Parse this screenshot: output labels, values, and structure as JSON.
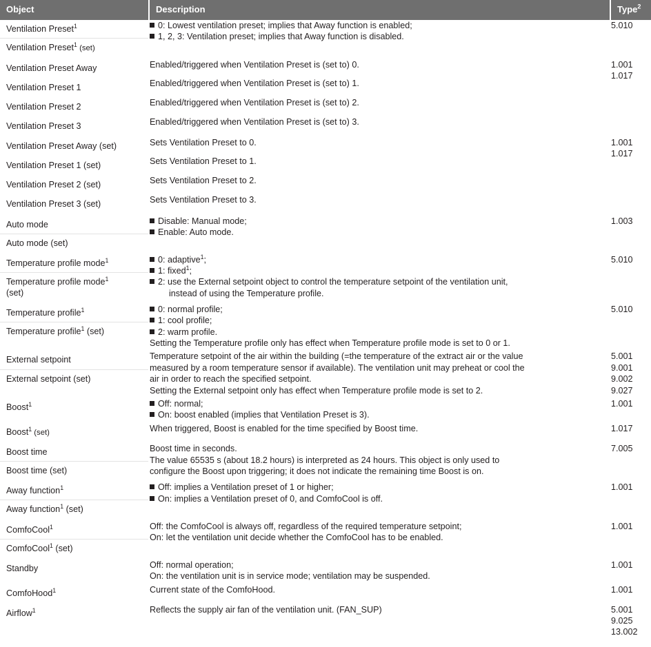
{
  "table": {
    "headers": {
      "object": "Object",
      "description": "Description",
      "type": "Type",
      "type_superscript": "2"
    },
    "header_bg": "#6f6f6f",
    "header_fg": "#ffffff",
    "groups": [
      {
        "objects": [
          {
            "name": "Ventilation Preset",
            "sup": "1",
            "suffix": ""
          },
          {
            "name": "Ventilation Preset",
            "sup": "1",
            "suffix": " (set)"
          }
        ],
        "description_lines": [
          {
            "bullet": true,
            "text": "0: Lowest ventilation preset; implies that Away function is enabled;"
          },
          {
            "bullet": true,
            "text": "1, 2, 3: Ventilation preset; implies that Away function is disabled."
          }
        ],
        "types": [
          "5.010"
        ]
      },
      {
        "objects": [
          {
            "name": "Ventilation Preset Away",
            "sup": "",
            "suffix": ""
          }
        ],
        "description_lines": [
          {
            "bullet": false,
            "text": "Enabled/triggered when Ventilation Preset is (set to) 0."
          }
        ],
        "types": [
          "1.001",
          "1.017"
        ],
        "rows": [
          {
            "object": "Ventilation Preset Away",
            "description": "Enabled/triggered when Ventilation Preset is (set to) 0."
          },
          {
            "object": "Ventilation Preset 1",
            "description": "Enabled/triggered when Ventilation Preset is (set to) 1."
          },
          {
            "object": "Ventilation Preset 2",
            "description": "Enabled/triggered when Ventilation Preset is (set to) 2."
          },
          {
            "object": "Ventilation Preset 3",
            "description": "Enabled/triggered when Ventilation Preset is (set to) 3."
          }
        ]
      },
      {
        "types": [
          "1.001",
          "1.017"
        ],
        "rows": [
          {
            "object": "Ventilation Preset Away (set)",
            "description": "Sets Ventilation Preset to 0."
          },
          {
            "object": "Ventilation Preset 1 (set)",
            "description": "Sets Ventilation Preset to 1."
          },
          {
            "object": "Ventilation Preset 2 (set)",
            "description": "Sets Ventilation Preset to 2."
          },
          {
            "object": "Ventilation Preset 3 (set)",
            "description": "Sets Ventilation Preset to 3."
          }
        ]
      },
      {
        "objects": [
          {
            "name": "Auto mode",
            "sup": "",
            "suffix": ""
          },
          {
            "name": "Auto mode",
            "sup": "",
            "suffix": " (set)"
          }
        ],
        "description_lines": [
          {
            "bullet": true,
            "text": "Disable:  Manual mode;"
          },
          {
            "bullet": true,
            "text": "Enable: Auto mode."
          }
        ],
        "types": [
          "1.003"
        ]
      },
      {
        "objects": [
          {
            "name": "Temperature profile mode",
            "sup": "1",
            "suffix": ""
          },
          {
            "name": "Temperature profile mode",
            "sup": "1",
            "suffix": " (set)"
          }
        ],
        "types": [
          "5.010"
        ]
      },
      {
        "objects": [
          {
            "name": "Temperature profile",
            "sup": "1",
            "suffix": ""
          },
          {
            "name": "Temperature profile",
            "sup": "1",
            "suffix": " (set)"
          }
        ],
        "types": [
          "5.010"
        ]
      },
      {
        "objects": [
          {
            "name": "External setpoint",
            "sup": "",
            "suffix": ""
          },
          {
            "name": "External setpoint",
            "sup": "",
            "suffix": " (set)"
          }
        ],
        "types": [
          "5.001",
          "9.001",
          "9.002",
          "9.027"
        ]
      },
      {
        "objects": [
          {
            "name": "Boost",
            "sup": "1",
            "suffix": ""
          }
        ],
        "types": [
          "1.001"
        ]
      },
      {
        "objects": [
          {
            "name": "Boost",
            "sup": "1",
            "suffix": " (set)"
          }
        ],
        "types": [
          "1.017"
        ]
      },
      {
        "objects": [
          {
            "name": "Boost time",
            "sup": "",
            "suffix": ""
          },
          {
            "name": "Boost time",
            "sup": "",
            "suffix": " (set)"
          }
        ],
        "types": [
          "7.005"
        ]
      },
      {
        "objects": [
          {
            "name": "Away function",
            "sup": "1",
            "suffix": ""
          },
          {
            "name": "Away function",
            "sup": "1",
            "suffix": " (set)"
          }
        ],
        "types": [
          "1.001"
        ]
      },
      {
        "objects": [
          {
            "name": "ComfoCool",
            "sup": "1",
            "suffix": ""
          },
          {
            "name": "ComfoCool",
            "sup": "1",
            "suffix": " (set)"
          }
        ],
        "types": [
          "1.001"
        ]
      },
      {
        "objects": [
          {
            "name": "Standby",
            "sup": "",
            "suffix": ""
          }
        ],
        "types": [
          "1.001"
        ]
      },
      {
        "objects": [
          {
            "name": "ComfoHood",
            "sup": "1",
            "suffix": ""
          }
        ],
        "types": [
          "1.001"
        ]
      },
      {
        "objects": [
          {
            "name": "Airflow",
            "sup": "1",
            "suffix": ""
          }
        ],
        "types": [
          "5.001",
          "9.025",
          "13.002"
        ]
      }
    ],
    "cells": {
      "vp_obj_1": "Ventilation Preset",
      "vp_obj_1_sup": "1",
      "vp_obj_2": "Ventilation Preset",
      "vp_obj_2_sup": "1",
      "vp_obj_2_suffix": " (set)",
      "vp_desc_1": "0: Lowest ventilation preset; implies that Away function is enabled;",
      "vp_desc_2": "1, 2, 3: Ventilation preset; implies that Away function is disabled.",
      "vp_type": "5.010",
      "vpa_obj": "Ventilation Preset Away",
      "vpa_desc": "Enabled/triggered when Ventilation Preset is (set to) 0.",
      "vp1_obj": "Ventilation Preset 1",
      "vp1_desc": "Enabled/triggered when Ventilation Preset is (set to) 1.",
      "vp2_obj": "Ventilation Preset 2",
      "vp2_desc": "Enabled/triggered when Ventilation Preset is (set to) 2.",
      "vp3_obj": "Ventilation Preset 3",
      "vp3_desc": "Enabled/triggered when Ventilation Preset is (set to) 3.",
      "vpget_type_a": "1.001",
      "vpget_type_b": "1.017",
      "vpas_obj": "Ventilation Preset Away (set)",
      "vpas_desc": "Sets Ventilation Preset to 0.",
      "vp1s_obj": "Ventilation Preset 1 (set)",
      "vp1s_desc": "Sets Ventilation Preset to 1.",
      "vp2s_obj": "Ventilation Preset 2 (set)",
      "vp2s_desc": "Sets Ventilation Preset to 2.",
      "vp3s_obj": "Ventilation Preset 3 (set)",
      "vp3s_desc": "Sets Ventilation Preset to 3.",
      "vpset_type_a": "1.001",
      "vpset_type_b": "1.017",
      "auto_obj_1": "Auto mode",
      "auto_obj_2": "Auto mode (set)",
      "auto_desc_1": "Disable:  Manual mode;",
      "auto_desc_2": "Enable: Auto mode.",
      "auto_type": "1.003",
      "tpm_obj_1": "Temperature profile mode",
      "tpm_obj_1_sup": "1",
      "tpm_obj_2": "Temperature profile mode",
      "tpm_obj_2_sup": "1",
      "tpm_obj_2_suffix": "(set)",
      "tpm_desc_1": "0: adaptive",
      "tpm_desc_1_sup": "1",
      "tpm_desc_1_tail": ";",
      "tpm_desc_2": "1: fixed",
      "tpm_desc_2_sup": "1",
      "tpm_desc_2_tail": ";",
      "tpm_desc_3": "2: use the External setpoint object to control the temperature setpoint of the ventilation unit,",
      "tpm_desc_4": "instead of using the Temperature profile.",
      "tpm_type": "5.010",
      "tp_obj_1": "Temperature profile",
      "tp_obj_1_sup": "1",
      "tp_obj_2": "Temperature profile",
      "tp_obj_2_sup": "1",
      "tp_obj_2_suffix": " (set)",
      "tp_desc_1": "0: normal profile;",
      "tp_desc_2": "1: cool profile;",
      "tp_desc_3": "2: warm profile.",
      "tp_desc_4": "Setting the Temperature profile only has effect when Temperature profile mode is set to 0 or 1.",
      "tp_type": "5.010",
      "es_obj_1": "External setpoint",
      "es_obj_2": "External setpoint (set)",
      "es_desc_1": "Temperature setpoint of the air within the building (=the temperature of the extract air or the value",
      "es_desc_2": "measured by a room temperature sensor if available). The ventilation unit may preheat or cool the",
      "es_desc_3": "air in order to reach the specified setpoint.",
      "es_desc_4": "Setting the External setpoint only has effect when Temperature profile mode is set to 2.",
      "es_type_1": "5.001",
      "es_type_2": "9.001",
      "es_type_3": "9.002",
      "es_type_4": "9.027",
      "boost_obj": "Boost",
      "boost_obj_sup": "1",
      "boost_desc_1": "Off: normal;",
      "boost_desc_2": "On: boost enabled (implies that Ventilation Preset is 3).",
      "boost_type": "1.001",
      "boosts_obj": "Boost",
      "boosts_obj_sup": "1",
      "boosts_obj_suffix": " (set)",
      "boosts_desc": "When triggered, Boost is enabled for the time specified by Boost time.",
      "boosts_type": "1.017",
      "bt_obj_1": "Boost time",
      "bt_obj_2": "Boost time (set)",
      "bt_desc_1": "Boost time in seconds.",
      "bt_desc_2": "The value 65535 s (about 18.2 hours) is interpreted as 24 hours. This object is only used to",
      "bt_desc_3": "configure the Boost upon triggering; it does not indicate the remaining time Boost is on.",
      "bt_type": "7.005",
      "af_obj_1": "Away function",
      "af_obj_1_sup": "1",
      "af_obj_2": "Away function",
      "af_obj_2_sup": "1",
      "af_obj_2_suffix": " (set)",
      "af_desc_1": "Off: implies a Ventilation preset of 1 or higher;",
      "af_desc_2": "On: implies a Ventilation preset of 0, and ComfoCool is off.",
      "af_type": "1.001",
      "cc_obj_1": "ComfoCool",
      "cc_obj_1_sup": "1",
      "cc_obj_2": "ComfoCool",
      "cc_obj_2_sup": "1",
      "cc_obj_2_suffix": " (set)",
      "cc_desc_1": "Off: the ComfoCool is always off, regardless of the required temperature setpoint;",
      "cc_desc_2": "On: let the ventilation unit decide whether the ComfoCool has to be enabled.",
      "cc_type": "1.001",
      "sb_obj": "Standby",
      "sb_desc_1": "Off: normal operation;",
      "sb_desc_2": "On: the ventilation unit is in service mode; ventilation may be suspended.",
      "sb_type": "1.001",
      "ch_obj": "ComfoHood",
      "ch_obj_sup": "1",
      "ch_desc": "Current state of the ComfoHood.",
      "ch_type": "1.001",
      "air_obj": "Airflow",
      "air_obj_sup": "1",
      "air_desc": "Reflects the supply air fan of the ventilation unit. (FAN_SUP)",
      "air_type_1": "5.001",
      "air_type_2": "9.025",
      "air_type_3": "13.002"
    }
  }
}
